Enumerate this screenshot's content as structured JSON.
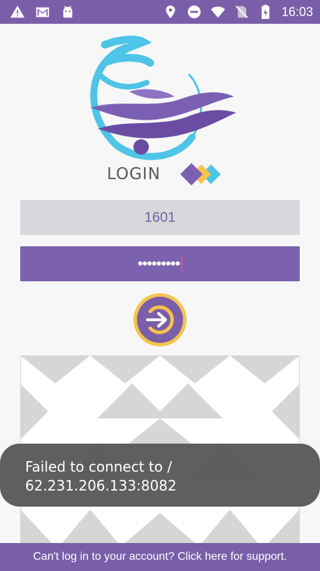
{
  "status_bar": {
    "time": "16:03",
    "left_icons": [
      "warning-icon",
      "gmail-icon",
      "android-icon"
    ],
    "right_icons": [
      "location-icon",
      "do-not-disturb-icon",
      "wifi-icon",
      "no-sim-icon",
      "battery-icon"
    ]
  },
  "login": {
    "heading": "LOGIN",
    "username_value": "1601",
    "password_value": "•••••••••"
  },
  "toast": {
    "message": "Failed to connect to /\n62.231.206.133:8082"
  },
  "footer": {
    "support_link": "Can't log in to your account? Click here for support."
  },
  "colors": {
    "primary": "#7a5fa8",
    "accent_yellow": "#f6c34d",
    "accent_cyan": "#4ec4e6"
  }
}
